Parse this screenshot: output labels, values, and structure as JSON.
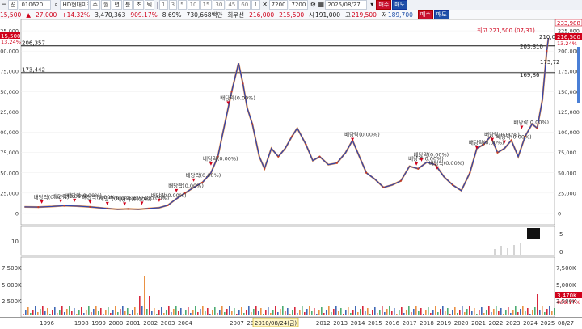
{
  "toolbar": {
    "view_mode": "젼",
    "code": "010620",
    "name": "HD현대미포",
    "periods": [
      "주",
      "월",
      "년",
      "분",
      "초",
      "틱"
    ],
    "intervals": [
      "1",
      "3",
      "5",
      "10",
      "15",
      "30",
      "45",
      "60",
      "1"
    ],
    "count": "7200",
    "count_total": "7200",
    "date": "2025/08/27",
    "buy_label": "매수",
    "sell_label": "매도"
  },
  "quote": {
    "price": "15,500",
    "change": "27,000",
    "change_pct": "+14.32%",
    "volume": "3,470,363",
    "vol_ratio": "909.17%",
    "turnover": "8.69%",
    "value": "730,668백만",
    "prev_label": "회우선",
    "prev": "216,000",
    "close": "215,500",
    "open_label": "시",
    "open": "191,000",
    "high_label": "고",
    "high": "219,500",
    "low_label": "저",
    "low": "189,700"
  },
  "price_panel": {
    "ticks": [
      "225,000",
      "200,000",
      "175,000",
      "150,000",
      "125,000",
      "100,000",
      "75,000",
      "50,000",
      "25,000",
      "0"
    ],
    "right_ticks": [
      "225,000",
      "200,000",
      "175,000",
      "150,000",
      "125,000",
      "100,000",
      "75,000",
      "50,000",
      "25,000",
      "0"
    ],
    "hlines": [
      {
        "label": "206,357",
        "value": 206357
      },
      {
        "label": "173,442",
        "value": 173442
      }
    ],
    "left_badges": [
      {
        "text": "15,500",
        "color": "#d0021b"
      },
      {
        "text": "13,24%",
        "color": "#d0021b"
      }
    ],
    "right_badges": [
      {
        "text": "233,988",
        "color": "#d0021b"
      },
      {
        "text": "216,500",
        "color": "#d0021b"
      },
      {
        "text": "13.24%",
        "color": "#d0021b"
      }
    ],
    "high_annotation": "최고 221,500 (07/31)",
    "right_labels": [
      "210,0",
      "203,810",
      "175,72",
      "169,86"
    ],
    "dividend_label": "배당락(0.00%)",
    "dividend_points": [
      {
        "x": 1996.2,
        "y": 8000
      },
      {
        "x": 1997.3,
        "y": 9000
      },
      {
        "x": 1998.1,
        "y": 10000
      },
      {
        "x": 1999.0,
        "y": 8000
      },
      {
        "x": 2000.0,
        "y": 6000
      },
      {
        "x": 2001.0,
        "y": 5500
      },
      {
        "x": 2002.0,
        "y": 6500
      },
      {
        "x": 2003.0,
        "y": 10000
      },
      {
        "x": 2004.0,
        "y": 22000
      },
      {
        "x": 2005.0,
        "y": 35000
      },
      {
        "x": 2006.0,
        "y": 55000
      },
      {
        "x": 2007.0,
        "y": 130000
      },
      {
        "x": 2014.2,
        "y": 85000
      },
      {
        "x": 2017.9,
        "y": 55000
      },
      {
        "x": 2018.2,
        "y": 60000
      },
      {
        "x": 2019.1,
        "y": 50000
      },
      {
        "x": 2021.4,
        "y": 75000
      },
      {
        "x": 2022.3,
        "y": 85000
      },
      {
        "x": 2023.0,
        "y": 82000
      },
      {
        "x": 2024.0,
        "y": 100000
      }
    ],
    "series": [
      {
        "x": 1995.2,
        "y": 8000
      },
      {
        "x": 1996.0,
        "y": 7800
      },
      {
        "x": 1996.8,
        "y": 8500
      },
      {
        "x": 1997.5,
        "y": 9500
      },
      {
        "x": 1998.2,
        "y": 9000
      },
      {
        "x": 1999.0,
        "y": 8000
      },
      {
        "x": 1999.5,
        "y": 7000
      },
      {
        "x": 2000.0,
        "y": 6000
      },
      {
        "x": 2000.6,
        "y": 5000
      },
      {
        "x": 2001.2,
        "y": 5500
      },
      {
        "x": 2001.8,
        "y": 5000
      },
      {
        "x": 2002.4,
        "y": 6000
      },
      {
        "x": 2003.0,
        "y": 7000
      },
      {
        "x": 2003.5,
        "y": 10000
      },
      {
        "x": 2004.0,
        "y": 18000
      },
      {
        "x": 2004.5,
        "y": 25000
      },
      {
        "x": 2005.0,
        "y": 32000
      },
      {
        "x": 2005.5,
        "y": 38000
      },
      {
        "x": 2006.0,
        "y": 50000
      },
      {
        "x": 2006.4,
        "y": 70000
      },
      {
        "x": 2006.8,
        "y": 110000
      },
      {
        "x": 2007.2,
        "y": 150000
      },
      {
        "x": 2007.6,
        "y": 185000
      },
      {
        "x": 2007.85,
        "y": 160000
      },
      {
        "x": 2008.1,
        "y": 130000
      },
      {
        "x": 2008.4,
        "y": 110000
      },
      {
        "x": 2008.8,
        "y": 70000
      },
      {
        "x": 2009.1,
        "y": 55000
      },
      {
        "x": 2009.5,
        "y": 80000
      },
      {
        "x": 2009.9,
        "y": 70000
      },
      {
        "x": 2010.3,
        "y": 80000
      },
      {
        "x": 2010.7,
        "y": 95000
      },
      {
        "x": 2011.0,
        "y": 105000
      },
      {
        "x": 2011.5,
        "y": 85000
      },
      {
        "x": 2011.9,
        "y": 65000
      },
      {
        "x": 2012.3,
        "y": 70000
      },
      {
        "x": 2012.8,
        "y": 60000
      },
      {
        "x": 2013.3,
        "y": 62000
      },
      {
        "x": 2013.8,
        "y": 75000
      },
      {
        "x": 2014.2,
        "y": 90000
      },
      {
        "x": 2014.6,
        "y": 70000
      },
      {
        "x": 2015.0,
        "y": 50000
      },
      {
        "x": 2015.5,
        "y": 42000
      },
      {
        "x": 2016.0,
        "y": 32000
      },
      {
        "x": 2016.5,
        "y": 35000
      },
      {
        "x": 2017.0,
        "y": 40000
      },
      {
        "x": 2017.5,
        "y": 58000
      },
      {
        "x": 2018.0,
        "y": 55000
      },
      {
        "x": 2018.5,
        "y": 63000
      },
      {
        "x": 2019.0,
        "y": 60000
      },
      {
        "x": 2019.5,
        "y": 45000
      },
      {
        "x": 2020.0,
        "y": 35000
      },
      {
        "x": 2020.5,
        "y": 28000
      },
      {
        "x": 2021.0,
        "y": 50000
      },
      {
        "x": 2021.4,
        "y": 80000
      },
      {
        "x": 2021.8,
        "y": 85000
      },
      {
        "x": 2022.2,
        "y": 95000
      },
      {
        "x": 2022.6,
        "y": 75000
      },
      {
        "x": 2023.0,
        "y": 80000
      },
      {
        "x": 2023.4,
        "y": 90000
      },
      {
        "x": 2023.8,
        "y": 70000
      },
      {
        "x": 2024.2,
        "y": 95000
      },
      {
        "x": 2024.6,
        "y": 110000
      },
      {
        "x": 2024.9,
        "y": 105000
      },
      {
        "x": 2025.2,
        "y": 140000
      },
      {
        "x": 2025.45,
        "y": 200000
      },
      {
        "x": 2025.55,
        "y": 216000
      }
    ]
  },
  "indicator_panel": {
    "ticks": [
      "10"
    ],
    "right_ticks": [
      "5",
      "0"
    ]
  },
  "volume_panel": {
    "ticks": [
      "7,500K",
      "5,000K",
      "2,500K"
    ],
    "right_ticks": [
      "7,500K",
      "5,000K",
      "2,500K"
    ],
    "right_badges": [
      {
        "text": "3,470K",
        "color": "#d0021b"
      },
      {
        "text": "909.17%",
        "color": "#d0021b"
      }
    ]
  },
  "xaxis": {
    "labels": [
      "1996",
      "1998",
      "1999",
      "2000",
      "2001",
      "2002",
      "2003",
      "2004",
      "2007",
      "2008",
      "2009",
      "2012",
      "2013",
      "2014",
      "2015",
      "2016",
      "2017",
      "2018",
      "2019",
      "2020",
      "2021",
      "2022",
      "2023",
      "2024",
      "2025",
      "08/27"
    ],
    "cursor_label": "2010/08/24(금)"
  }
}
